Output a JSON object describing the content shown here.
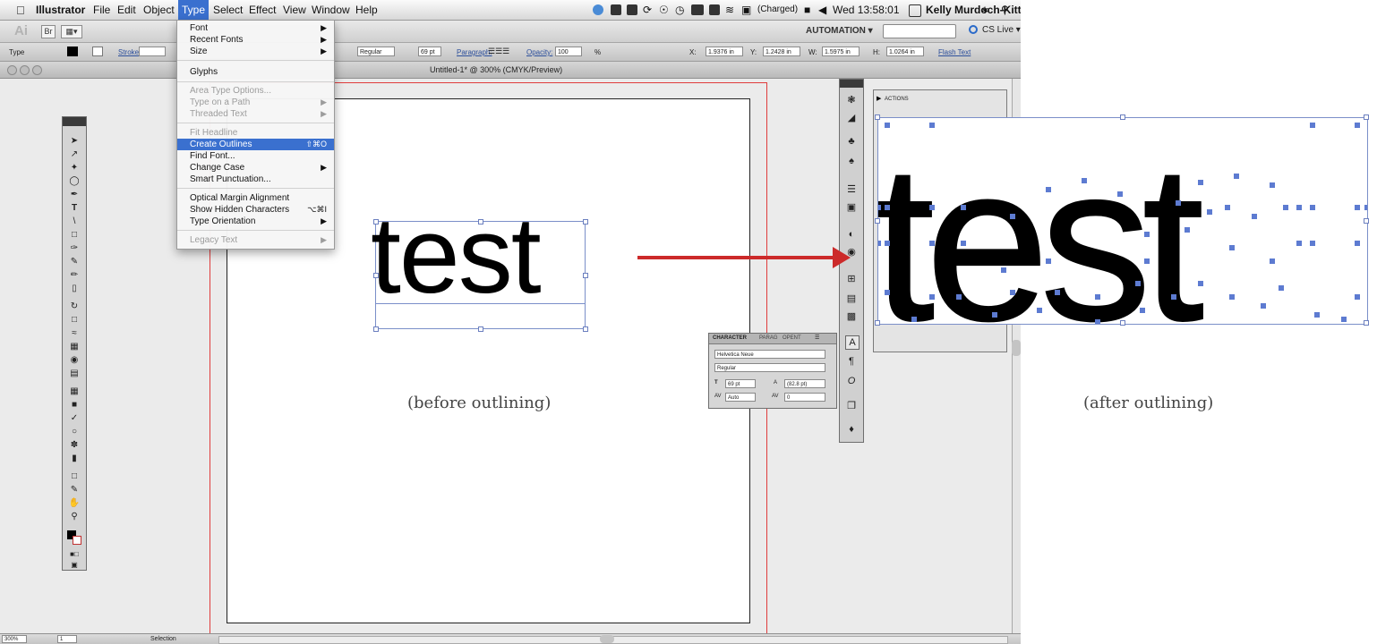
{
  "menubar": {
    "app": "Illustrator",
    "items": [
      "File",
      "Edit",
      "Object",
      "Type",
      "Select",
      "Effect",
      "View",
      "Window",
      "Help"
    ],
    "active": "Type",
    "battery": "(Charged)",
    "clock": "Wed 13:58:01",
    "user": "Kelly Murdoch-Kitt"
  },
  "appbar": {
    "logo": "Ai",
    "br_label": "Br",
    "workspace": "AUTOMATION ▾",
    "cs_live": "CS Live ▾"
  },
  "controlbar": {
    "mode": "Type",
    "stroke": "Stroke:",
    "style": "Regular",
    "size": "69 pt",
    "paragraph": "Paragraph:",
    "opacity_label": "Opacity:",
    "opacity": "100",
    "opacity_unit": "%",
    "x_label": "X:",
    "x": "1.9376 in",
    "y_label": "Y:",
    "y": "1.2428 in",
    "w_label": "W:",
    "w": "1.5975 in",
    "h_label": "H:",
    "h": "1.0264 in",
    "flash_text": "Flash Text"
  },
  "document": {
    "title": "Untitled-1* @ 300% (CMYK/Preview)",
    "sample_text": "test"
  },
  "type_menu": {
    "items": [
      {
        "label": "Font",
        "shortcut": "",
        "submenu": true,
        "disabled": false,
        "highlighted": false
      },
      {
        "label": "Recent Fonts",
        "shortcut": "",
        "submenu": true,
        "disabled": false,
        "highlighted": false
      },
      {
        "label": "Size",
        "shortcut": "",
        "submenu": true,
        "disabled": false,
        "highlighted": false
      },
      {
        "label": "Glyphs",
        "shortcut": "",
        "submenu": false,
        "disabled": false,
        "highlighted": false
      },
      {
        "label": "Area Type Options...",
        "shortcut": "",
        "submenu": false,
        "disabled": true,
        "highlighted": false
      },
      {
        "label": "Type on a Path",
        "shortcut": "",
        "submenu": true,
        "disabled": true,
        "highlighted": false
      },
      {
        "label": "Threaded Text",
        "shortcut": "",
        "submenu": true,
        "disabled": true,
        "highlighted": false
      },
      {
        "label": "Fit Headline",
        "shortcut": "",
        "submenu": false,
        "disabled": true,
        "highlighted": false
      },
      {
        "label": "Create Outlines",
        "shortcut": "⇧⌘O",
        "submenu": false,
        "disabled": false,
        "highlighted": true
      },
      {
        "label": "Find Font...",
        "shortcut": "",
        "submenu": false,
        "disabled": false,
        "highlighted": false
      },
      {
        "label": "Change Case",
        "shortcut": "",
        "submenu": true,
        "disabled": false,
        "highlighted": false
      },
      {
        "label": "Smart Punctuation...",
        "shortcut": "",
        "submenu": false,
        "disabled": false,
        "highlighted": false
      },
      {
        "label": "Optical Margin Alignment",
        "shortcut": "",
        "submenu": false,
        "disabled": false,
        "highlighted": false
      },
      {
        "label": "Show Hidden Characters",
        "shortcut": "⌥⌘I",
        "submenu": false,
        "disabled": false,
        "highlighted": false
      },
      {
        "label": "Type Orientation",
        "shortcut": "",
        "submenu": true,
        "disabled": false,
        "highlighted": false
      },
      {
        "label": "Legacy Text",
        "shortcut": "",
        "submenu": true,
        "disabled": true,
        "highlighted": false
      }
    ]
  },
  "actions_panel": {
    "title": "ACTIONS"
  },
  "character_panel": {
    "tabs": [
      "CHARACTER",
      "PARAG",
      "OPENT"
    ],
    "font_family": "Helvetica Neue",
    "font_style": "Regular",
    "size": "69 pt",
    "leading": "(82.8 pt)",
    "kerning": "Auto",
    "tracking": "0"
  },
  "statusbar": {
    "zoom": "300%",
    "page": "1",
    "tool": "Selection"
  },
  "illustration": {
    "before_caption": "(before outlining)",
    "after_caption": "(after outlining)",
    "after_text": "test"
  },
  "colors": {
    "menu_highlight": "#3a70cf",
    "arrow": "#cc2a2a",
    "selection": "#7b8fc9",
    "bleed": "#e03c3c",
    "anchor": "#5d7bd1"
  }
}
